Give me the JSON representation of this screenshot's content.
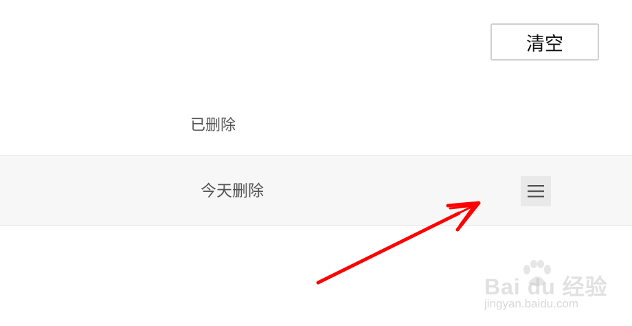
{
  "toolbar": {
    "clear_label": "清空"
  },
  "section": {
    "header": "已删除"
  },
  "list": {
    "rows": [
      {
        "label": "今天删除",
        "menu_icon": "hamburger-menu-icon"
      }
    ]
  },
  "annotation": {
    "arrow_color": "#ff0000"
  },
  "watermark": {
    "brand": "Bai du 经验",
    "url": "jingyan.baidu.com"
  },
  "colors": {
    "background": "#ffffff",
    "row_background": "#f7f7f7",
    "menu_button_background": "#e9e9e9",
    "divider": "#e6e6e6"
  }
}
